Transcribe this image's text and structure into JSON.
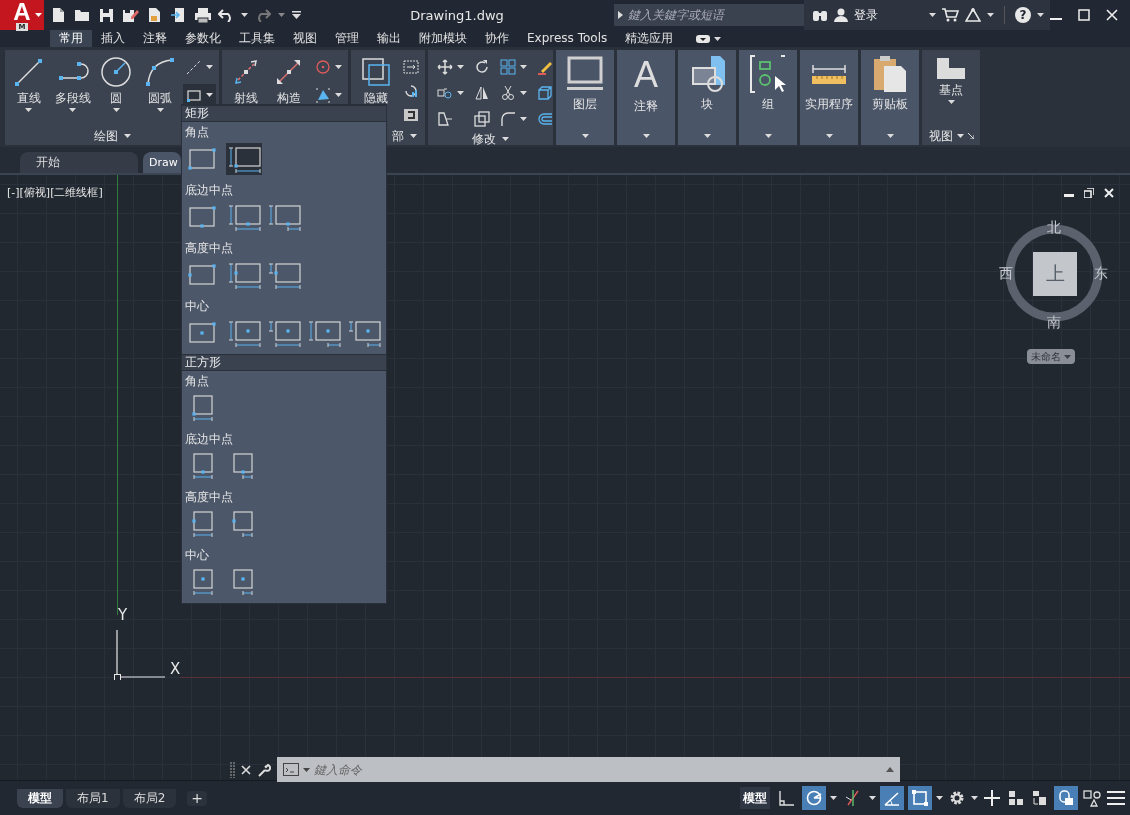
{
  "app_button": {
    "letter": "A",
    "sub": "M"
  },
  "window": {
    "title": "Drawing1.dwg"
  },
  "search": {
    "placeholder": "鍵入关鍵字或短语"
  },
  "sign_in": {
    "label": "登录"
  },
  "help": {
    "label": "?"
  },
  "ribbon_tabs": [
    {
      "label": "常用",
      "selected": true
    },
    {
      "label": "插入",
      "selected": false
    },
    {
      "label": "注释",
      "selected": false
    },
    {
      "label": "参数化",
      "selected": false
    },
    {
      "label": "工具集",
      "selected": false
    },
    {
      "label": "视图",
      "selected": false
    },
    {
      "label": "管理",
      "selected": false
    },
    {
      "label": "输出",
      "selected": false
    },
    {
      "label": "附加模块",
      "selected": false
    },
    {
      "label": "协作",
      "selected": false
    },
    {
      "label": "Express Tools",
      "selected": false
    },
    {
      "label": "精选应用",
      "selected": false
    }
  ],
  "ribbon": {
    "draw_panel": {
      "title": "绘图",
      "buttons": [
        "直线",
        "多段线",
        "圆",
        "圆弧"
      ]
    },
    "panel_2": {
      "buttons": [
        "射线",
        "构造"
      ]
    },
    "panel_3": {
      "button": "隐藏",
      "title": "部"
    },
    "modify_panel": {
      "title": "修改"
    },
    "panels": [
      {
        "label": "图层"
      },
      {
        "label": "注释",
        "glyph": "A"
      },
      {
        "label": "块"
      },
      {
        "label": "组"
      },
      {
        "label": "实用程序"
      },
      {
        "label": "剪贴板"
      }
    ],
    "view_panel": {
      "button": "基点",
      "title": "视图"
    }
  },
  "file_tabs": [
    {
      "label": "开始",
      "selected": false
    },
    {
      "label": "Draw",
      "selected": true
    }
  ],
  "viewport": {
    "label": "[-][俯视][二维线框]"
  },
  "viewcube": {
    "north": "北",
    "west": "西",
    "top": "上",
    "east": "东",
    "south": "南",
    "ucs_menu": "未命名"
  },
  "ucs": {
    "y": "Y",
    "x": "X"
  },
  "flyout": {
    "sections": [
      {
        "title": "矩形",
        "groups": [
          {
            "label": "角点",
            "options": [
              {
                "selected": false
              },
              {
                "selected": true
              }
            ]
          },
          {
            "label": "底边中点",
            "options": [
              {
                "selected": false
              },
              {
                "selected": false
              },
              {
                "selected": false
              }
            ]
          },
          {
            "label": "高度中点",
            "options": [
              {
                "selected": false
              },
              {
                "selected": false
              },
              {
                "selected": false
              }
            ]
          },
          {
            "label": "中心",
            "options": [
              {
                "selected": false
              },
              {
                "selected": false
              },
              {
                "selected": false
              },
              {
                "selected": false
              },
              {
                "selected": false
              }
            ]
          }
        ]
      },
      {
        "title": "正方形",
        "groups": [
          {
            "label": "角点",
            "options": [
              {
                "selected": false
              }
            ]
          },
          {
            "label": "底边中点",
            "options": [
              {
                "selected": false
              },
              {
                "selected": false
              }
            ]
          },
          {
            "label": "高度中点",
            "options": [
              {
                "selected": false
              },
              {
                "selected": false
              }
            ]
          },
          {
            "label": "中心",
            "options": [
              {
                "selected": false
              },
              {
                "selected": false
              }
            ]
          }
        ]
      }
    ]
  },
  "command_line": {
    "placeholder": "鍵入命令"
  },
  "layout_tabs": [
    {
      "label": "模型",
      "selected": true
    },
    {
      "label": "布局1",
      "selected": false
    },
    {
      "label": "布局2",
      "selected": false
    }
  ],
  "add_layout": "+",
  "status_bar": {
    "space": "模型",
    "toggles": [
      {
        "on": false
      },
      {
        "on": true
      },
      {
        "on": false
      },
      {
        "on": true
      },
      {
        "on": true
      },
      {
        "on": true
      }
    ]
  }
}
